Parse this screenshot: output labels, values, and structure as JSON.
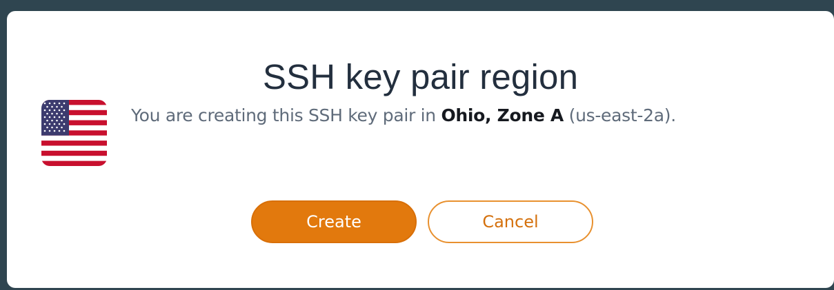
{
  "dialog": {
    "title": "SSH key pair region",
    "message_prefix": "You are creating this SSH key pair in ",
    "region_name": "Ohio, Zone A",
    "message_suffix": " (us-east-2a).",
    "flag_icon": "us-flag-icon"
  },
  "buttons": {
    "create_label": "Create",
    "cancel_label": "Cancel"
  },
  "colors": {
    "backdrop": "#2f4550",
    "primary_button": "#e2790d",
    "cancel_text": "#d4700c",
    "title_text": "#232f3e",
    "body_text": "#5f6b7a",
    "emphasis_text": "#16191f"
  }
}
